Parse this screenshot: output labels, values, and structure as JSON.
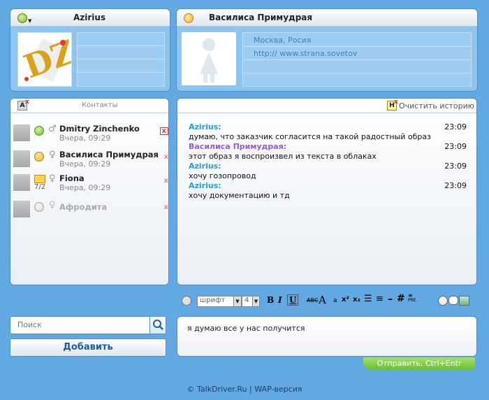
{
  "me": {
    "name": "Azirius",
    "avatar_text": "DZ"
  },
  "partner": {
    "name": "Василиса Примудрая",
    "city": "Москва, Росия",
    "url": "http:// www.strana.sovetov"
  },
  "contacts_header": "Контакты",
  "contacts": [
    {
      "name": "Dmitry Zinchenko",
      "time": "Вчера, 09:29",
      "status": "online",
      "gender": "♂",
      "delete": "x"
    },
    {
      "name": "Василиса Примудрая",
      "time": "Вчера, 09:29",
      "status": "away",
      "gender": "♀",
      "delete": "x"
    },
    {
      "name": "Fiona",
      "time": "Вчера, 09:29",
      "status": "message",
      "gender": "♀",
      "unread": "7/",
      "unread_new": "2",
      "delete": "x"
    },
    {
      "name": "Афродита",
      "time": "",
      "status": "offline",
      "gender": "♀",
      "delete": "x"
    }
  ],
  "clear_history": "Очистить историю",
  "messages": [
    {
      "from": "Azirius:",
      "text": "думаю, что заказчик согласится на такой радостный образ",
      "time": "23:09",
      "color": "#17a3d8"
    },
    {
      "from": "Василиса Примудрая:",
      "text": "этот образ я воспроизвел из текста в облаках",
      "time": "23:09",
      "color": "#9a59d6"
    },
    {
      "from": "Azirius:",
      "text": "хочу гозопровод",
      "time": "23:09",
      "color": "#17a3d8"
    },
    {
      "from": "Azirius:",
      "text": "хочу документацию и тд",
      "time": "23:09",
      "color": "#17a3d8"
    }
  ],
  "toolbar": {
    "font_value": "шрифт",
    "size_value": "4",
    "bold": "B",
    "italic": "I",
    "underline": "U",
    "big_a": "A",
    "abc": "АВС",
    "small_a": "a",
    "sup": "x²",
    "sub": "x₂",
    "hash": "#",
    "pre": "PRE"
  },
  "search": {
    "placeholder": "Поиск"
  },
  "add_button": "Добавить",
  "compose_text": "я думаю все у нас получится",
  "send_button": "Отправить, Ctrl+Entr",
  "footer": {
    "copyright": "© TalkDriver.Ru",
    "separator": "|",
    "wap": "WAP-версия"
  }
}
